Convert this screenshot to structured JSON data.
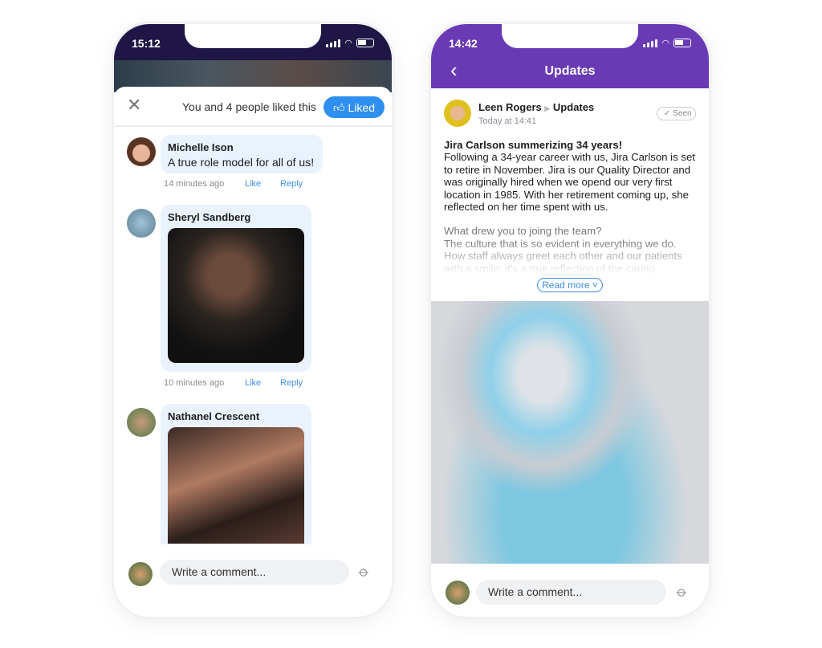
{
  "left_phone": {
    "status": {
      "time": "15:12"
    },
    "likes_text": "You and 4 people liked this",
    "liked_label": "Liked",
    "comments": [
      {
        "author": "Michelle Ison",
        "text": "A true role model for all of us!",
        "time": "14 minutes ago",
        "like": "Like",
        "reply": "Reply"
      },
      {
        "author": "Sheryl Sandberg",
        "time": "10 minutes ago",
        "like": "Like",
        "reply": "Reply"
      },
      {
        "author": "Nathanel Crescent"
      }
    ],
    "composer_placeholder": "Write a comment..."
  },
  "right_phone": {
    "status": {
      "time": "14:42"
    },
    "header_title": "Updates",
    "post": {
      "author": "Leen Rogers",
      "channel": "Updates",
      "timestamp": "Today at 14:41",
      "seen": "Seen",
      "title": "Jira Carlson summerizing 34 years!",
      "body": "Following a 34-year career with us, Jira Carlson is set to retire in November. Jira is our Quality Director and was originally hired when we opend our very first location in 1985. With her retirement coming up, she reflected on her time spent with us.",
      "question": "What drew you to joing the team?",
      "answer": "The culture that is so evident in everything we do. How staff always greet each other and our patients with a smile; it's a true reflection of the caring",
      "read_more": "Read more"
    },
    "composer_placeholder": "Write a comment..."
  },
  "colors": {
    "accent": "#2f8ff0",
    "purple": "#6a3ab5",
    "dark_header": "#1f1645",
    "bubble": "#e9f2fd"
  }
}
